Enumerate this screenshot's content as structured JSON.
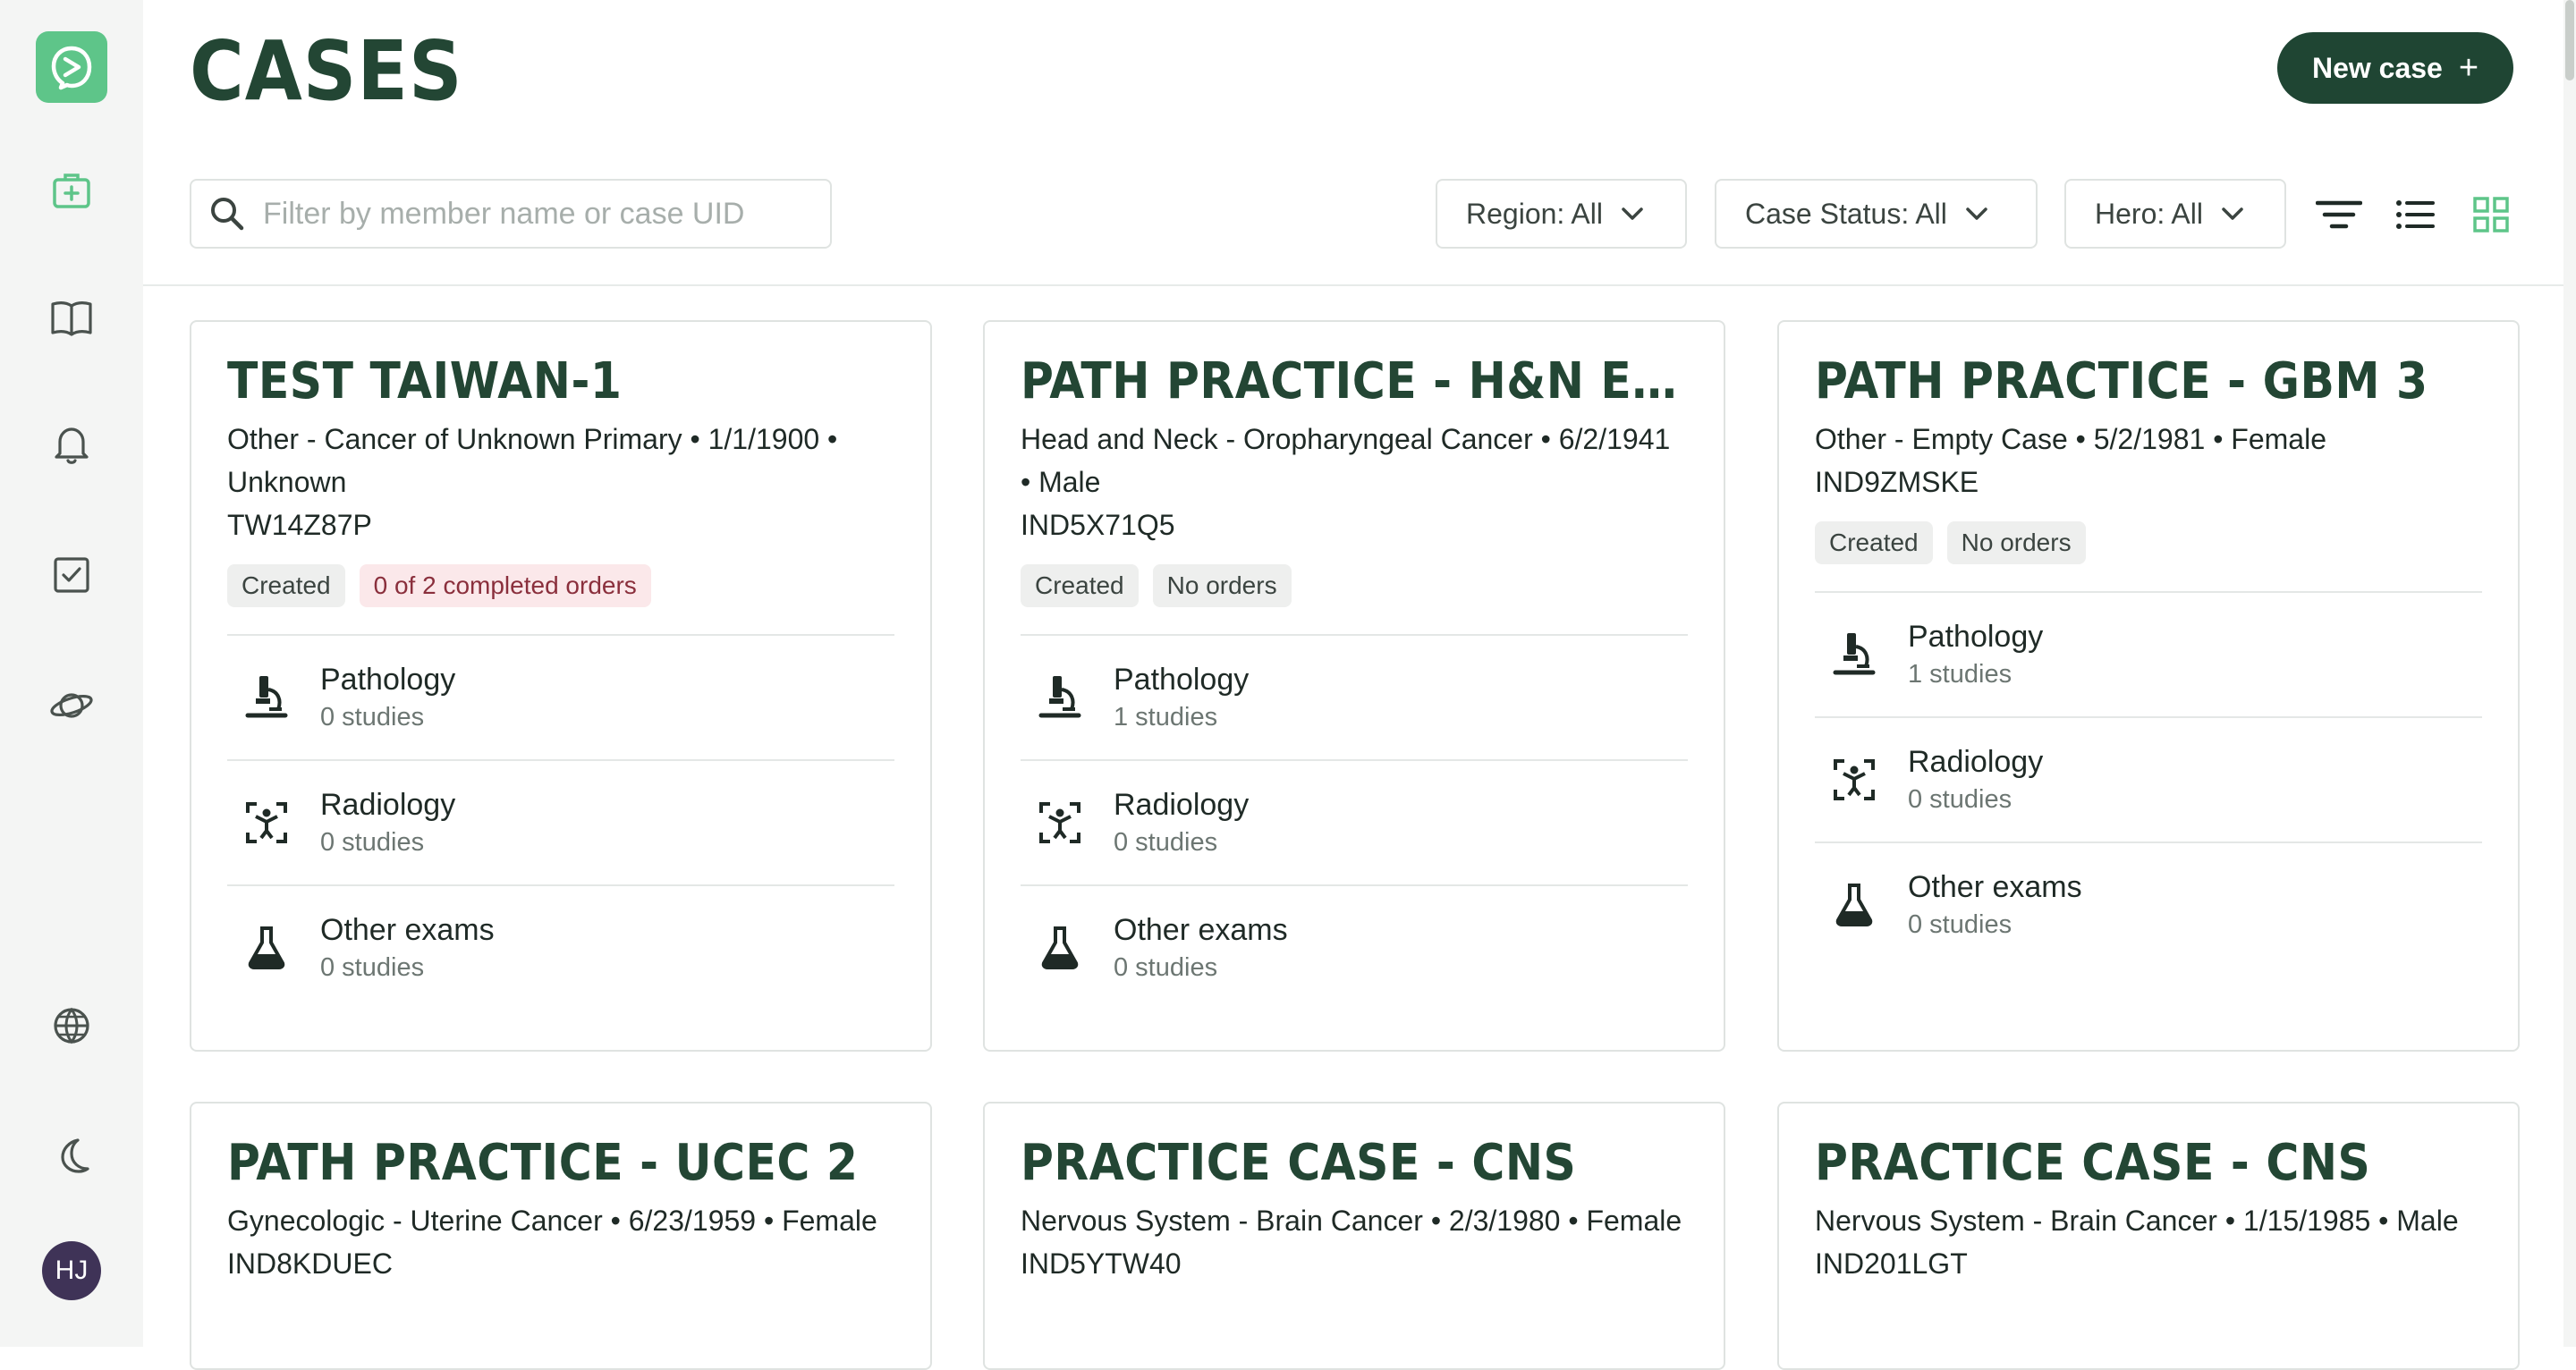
{
  "page": {
    "title": "CASES",
    "new_case_label": "New case",
    "new_case_icon": "plus-icon"
  },
  "sidebar": {
    "items": [
      {
        "name": "cases-nav-item",
        "icon": "medical-kit-icon",
        "active": true
      },
      {
        "name": "library-nav-item",
        "icon": "book-icon"
      },
      {
        "name": "notifications-nav-item",
        "icon": "bell-icon"
      },
      {
        "name": "tasks-nav-item",
        "icon": "checkbox-icon"
      },
      {
        "name": "explore-nav-item",
        "icon": "planet-icon"
      },
      {
        "name": "language-nav-item",
        "icon": "globe-icon"
      },
      {
        "name": "theme-nav-item",
        "icon": "moon-icon"
      }
    ],
    "avatar_initials": "HJ"
  },
  "filters": {
    "search_placeholder": "Filter by member name or case UID",
    "region": "Region: All",
    "case_status": "Case Status: All",
    "hero": "Hero: All"
  },
  "colors": {
    "brand": "#1f4533",
    "accent": "#5ec589",
    "title": "#234634"
  },
  "cards": [
    {
      "title": "TEST TAIWAN-1",
      "subtitle": "Other - Cancer of Unknown Primary • 1/1/1900 • Unknown",
      "uid": "TW14Z87P",
      "status": "Created",
      "orders": "0 of 2 completed orders",
      "categories": [
        {
          "name": "Pathology",
          "count": "0 studies"
        },
        {
          "name": "Radiology",
          "count": "0 studies"
        },
        {
          "name": "Other exams",
          "count": "0 studies"
        }
      ]
    },
    {
      "title": "PATH PRACTICE - H&N EPI...",
      "subtitle": "Head and Neck - Oropharyngeal Cancer • 6/2/1941 • Male",
      "uid": "IND5X71Q5",
      "status": "Created",
      "orders": "No orders",
      "categories": [
        {
          "name": "Pathology",
          "count": "1 studies"
        },
        {
          "name": "Radiology",
          "count": "0 studies"
        },
        {
          "name": "Other exams",
          "count": "0 studies"
        }
      ]
    },
    {
      "title": "PATH PRACTICE - GBM 3",
      "subtitle": "Other - Empty Case • 5/2/1981 • Female",
      "uid": "IND9ZMSKE",
      "status": "Created",
      "orders": "No orders",
      "categories": [
        {
          "name": "Pathology",
          "count": "1 studies"
        },
        {
          "name": "Radiology",
          "count": "0 studies"
        },
        {
          "name": "Other exams",
          "count": "0 studies"
        }
      ]
    },
    {
      "title": "PATH PRACTICE - UCEC 2",
      "subtitle": "Gynecologic - Uterine Cancer • 6/23/1959 • Female",
      "uid": "IND8KDUEC"
    },
    {
      "title": "PRACTICE CASE - CNS",
      "subtitle": "Nervous System - Brain Cancer • 2/3/1980 • Female",
      "uid": "IND5YTW40"
    },
    {
      "title": "PRACTICE CASE - CNS",
      "subtitle": "Nervous System - Brain Cancer • 1/15/1985 • Male",
      "uid": "IND201LGT"
    }
  ]
}
